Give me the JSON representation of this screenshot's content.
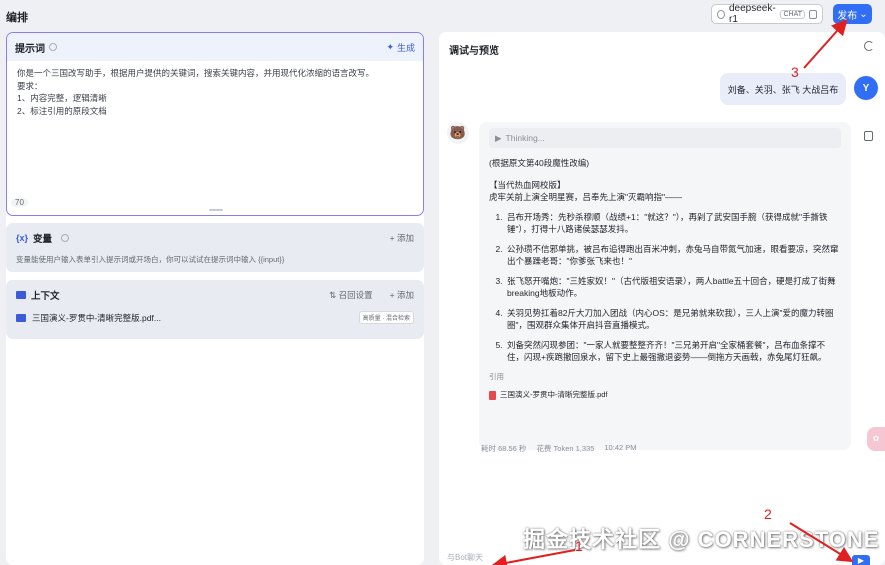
{
  "header": {
    "title": "编排",
    "model_name": "deepseek-r1",
    "model_badge": "CHAT",
    "publish_label": "发布"
  },
  "prompt": {
    "title": "提示词",
    "generate_label": "生成",
    "lines": [
      "你是一个三国改写助手，根据用户提供的关键词，搜索关键内容，并用现代化浓缩的语言改写。",
      "要求：",
      "1、内容完整，逻辑清晰",
      "2、标注引用的原段文档"
    ],
    "char_count": "70"
  },
  "variables": {
    "title": "变量",
    "add_label": "+ 添加",
    "description": "变量能使用户输入表单引入提示词或开场白，你可以试试在提示词中输入 {{input}}"
  },
  "context": {
    "title": "上下文",
    "recall_label": "召回设置",
    "add_label": "+ 添加",
    "file_name": "三国演义-罗贯中-清晰完整版.pdf...",
    "file_tag": "高质量 · 混合检索"
  },
  "preview": {
    "title": "调试与预览",
    "user_message": "刘备、关羽、张飞 大战吕布",
    "user_avatar": "Y",
    "thinking_label": "Thinking...",
    "answer_intro": "(根据原文第40段魔性改编)",
    "answer_heading": "【当代热血网校版】",
    "answer_lead": "虎牢关前上演全明星赛，吕奉先上演\"灭霸响指\"——",
    "items": [
      "吕布开场秀：先秒杀穆顺（战绩+1：\"就这？\"），再剁了武安国手腕（获得成就\"手撕铁锤\"），打得十八路诸侯瑟瑟发抖。",
      "公孙瓒不信邪单挑，被吕布追得跑出百米冲刺，赤兔马自带氮气加速，眼看要凉，突然窜出个暴躁老哥：\"你爹张飞来也！\"",
      "张飞怒开嘴炮：\"三姓家奴！\"（古代版祖安语录），两人battle五十回合，硬是打成了街舞breaking地板动作。",
      "关羽见势扛着82斤大刀加入团战（内心OS：是兄弟就来砍我），三人上演\"爱的魔力转圈圈\"，围观群众集体开启抖音直播模式。",
      "刘备突然闪现参团：\"一家人就要整整齐齐！\"三兄弟开启\"全家桶套餐\"，吕布血条撑不住，闪现+疾跑撤回泉水，留下史上最强撤退姿势——倒拖方天画戟，赤兔尾灯狂飙。"
    ],
    "cite_label": "引用",
    "cite_file": "三国演义-罗贯中-清晰完整版.pdf",
    "meta_time": "耗时 68.56 秒",
    "meta_tokens": "花费 Token 1,335",
    "meta_clock": "10:42 PM",
    "input_placeholder": "与Bot聊天"
  },
  "watermark": "掘金技术社区 @ CORNERSTONE",
  "annotations": [
    "1",
    "2",
    "3"
  ],
  "colors": {
    "accent": "#2f6ef5",
    "annotation": "#e02020",
    "prompt_border": "#8b7cf6"
  }
}
